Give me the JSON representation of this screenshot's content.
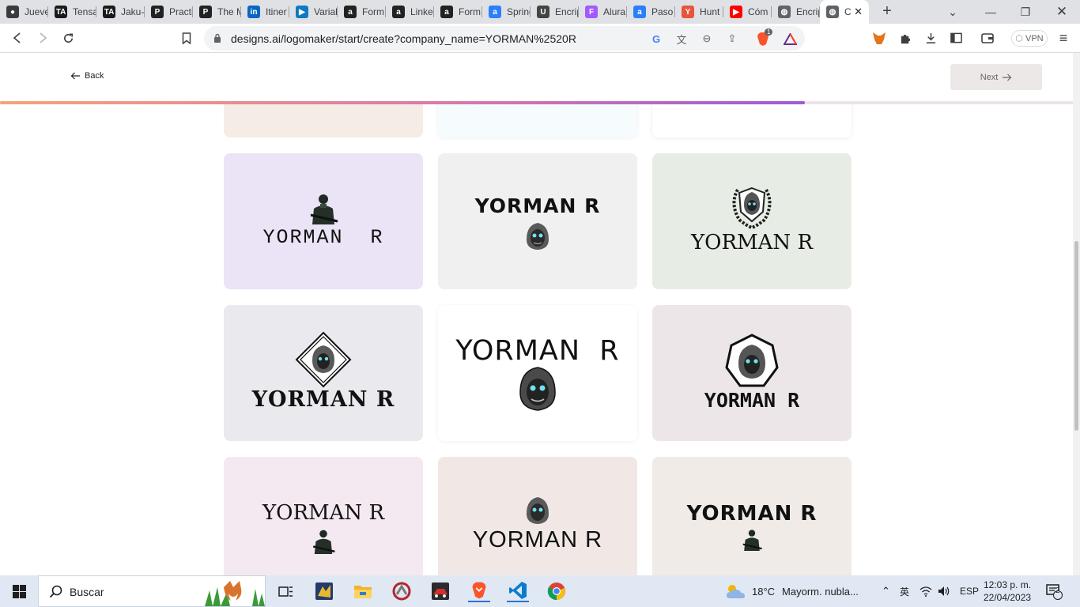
{
  "browser": {
    "tabs": [
      {
        "title": "Jueves",
        "color": "#3c3c3c",
        "glyph": "●"
      },
      {
        "title": "Tensa",
        "color": "#1a1a1a",
        "glyph": "TA"
      },
      {
        "title": "Jaku-",
        "color": "#1a1a1a",
        "glyph": "TA"
      },
      {
        "title": "Practi",
        "color": "#222222",
        "glyph": "P"
      },
      {
        "title": "The M",
        "color": "#222222",
        "glyph": "P"
      },
      {
        "title": "Itiner",
        "color": "#0a66c2",
        "glyph": "in"
      },
      {
        "title": "Variab",
        "color": "#0f7ac0",
        "glyph": "▶"
      },
      {
        "title": "Form",
        "color": "#222222",
        "glyph": "a"
      },
      {
        "title": "Linke",
        "color": "#222222",
        "glyph": "a"
      },
      {
        "title": "Form",
        "color": "#222222",
        "glyph": "a"
      },
      {
        "title": "Spring",
        "color": "#2d7ff9",
        "glyph": "a"
      },
      {
        "title": "Encrip",
        "color": "#444444",
        "glyph": "U"
      },
      {
        "title": "Alura",
        "color": "#a259ff",
        "glyph": "F"
      },
      {
        "title": "Paso",
        "color": "#2d7ff9",
        "glyph": "a"
      },
      {
        "title": "Hunt",
        "color": "#e8553e",
        "glyph": "Y"
      },
      {
        "title": "Cóm",
        "color": "#ff0000",
        "glyph": "▶"
      },
      {
        "title": "Encrip",
        "color": "#5f6368",
        "glyph": "◍"
      },
      {
        "title": "C",
        "color": "#5f6368",
        "glyph": "◍"
      }
    ],
    "url": "designs.ai/logomaker/start/create?company_name=YORMAN%2520R",
    "vpn_label": "VPN",
    "brave_badge": "1"
  },
  "page": {
    "back_label": "Back",
    "next_label": "Next",
    "progress": 0.75
  },
  "logos": {
    "company_name": "YORMAN R",
    "company_name_spaced": "YORMAN  R",
    "cards": [
      {
        "bg": "#f6ece6"
      },
      {
        "bg": "#f6fcfd"
      },
      {
        "bg": "#ffffff"
      },
      {
        "bg": "#ebe3f6"
      },
      {
        "bg": "#f0f0f0"
      },
      {
        "bg": "#e7ede4"
      },
      {
        "bg": "#e9e9ee"
      },
      {
        "bg": "#ffffff"
      },
      {
        "bg": "#ede6e8"
      },
      {
        "bg": "#f4e9f1"
      },
      {
        "bg": "#f1e8e6"
      },
      {
        "bg": "#f0ebe7"
      }
    ]
  },
  "taskbar": {
    "search_placeholder": "Buscar",
    "weather_temp": "18°C",
    "weather_desc": "Mayorm. nubla...",
    "language": "ESP",
    "time": "12:03 p. m.",
    "date": "22/04/2023",
    "notifications": "2"
  }
}
